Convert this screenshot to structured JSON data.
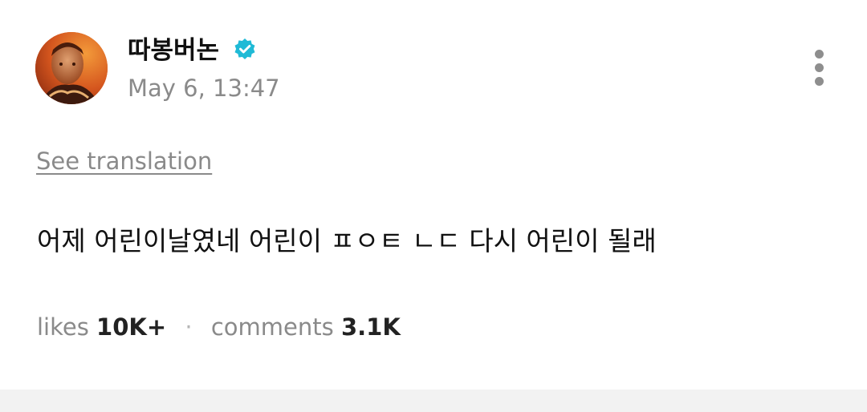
{
  "post": {
    "author": {
      "name": "따봉버논",
      "verified": true,
      "verified_icon": "verified-badge-icon",
      "avatar_icon": "avatar"
    },
    "date": "May 6, 13:47",
    "see_translation": "See translation",
    "body_text": "어제 어린이날였네 어린이 ㅍㅇㅌ ㄴㄷ 다시 어린이 될래",
    "stats": {
      "likes_label": "likes",
      "likes_value": "10K+",
      "separator": "·",
      "comments_label": "comments",
      "comments_value": "3.1K"
    },
    "more_icon": "more-vertical-icon"
  },
  "colors": {
    "verified": "#1fbad6",
    "muted_text": "#8a8a8a",
    "primary_text": "#111111",
    "footer_bg": "#f2f2f2"
  }
}
